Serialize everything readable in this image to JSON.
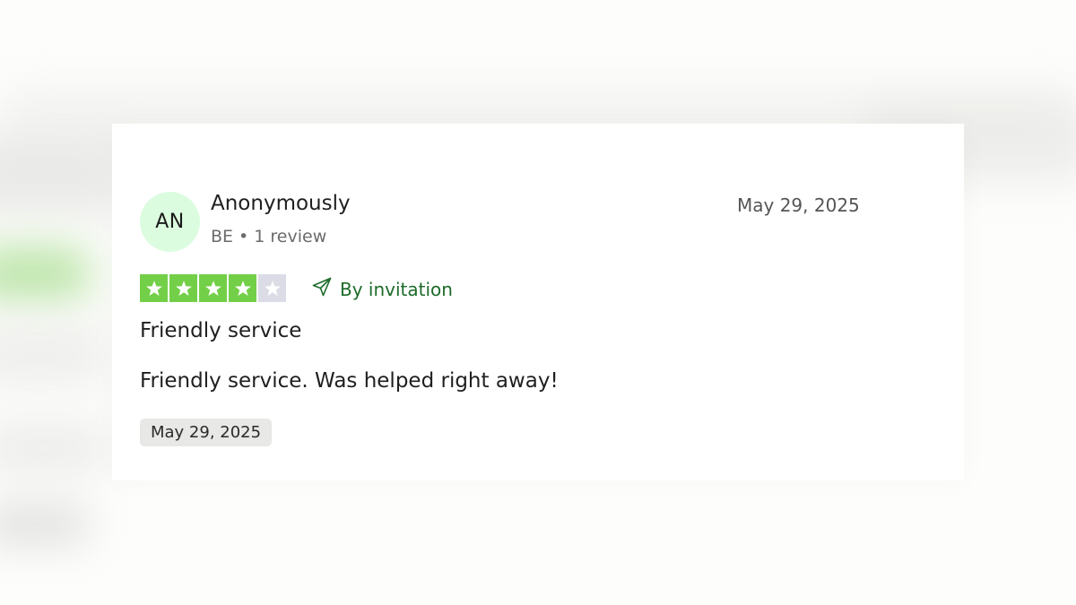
{
  "review": {
    "avatar_initials": "AN",
    "reviewer_name": "Anonymously",
    "country": "BE",
    "separator": "•",
    "review_count": "1 review",
    "date": "May 29, 2025",
    "rating": 4,
    "max_rating": 5,
    "verification_label": "By invitation",
    "verification_icon": "send-icon",
    "title": "Friendly service",
    "text": "Friendly service. Was helped right away!",
    "experience_date": "May 29, 2025"
  },
  "colors": {
    "star_filled": "#73cf48",
    "star_empty": "#dcdce6",
    "avatar_bg": "#dcfce0",
    "verification_text": "#1d6b2a",
    "date_pill_bg": "#e8e8e6"
  }
}
